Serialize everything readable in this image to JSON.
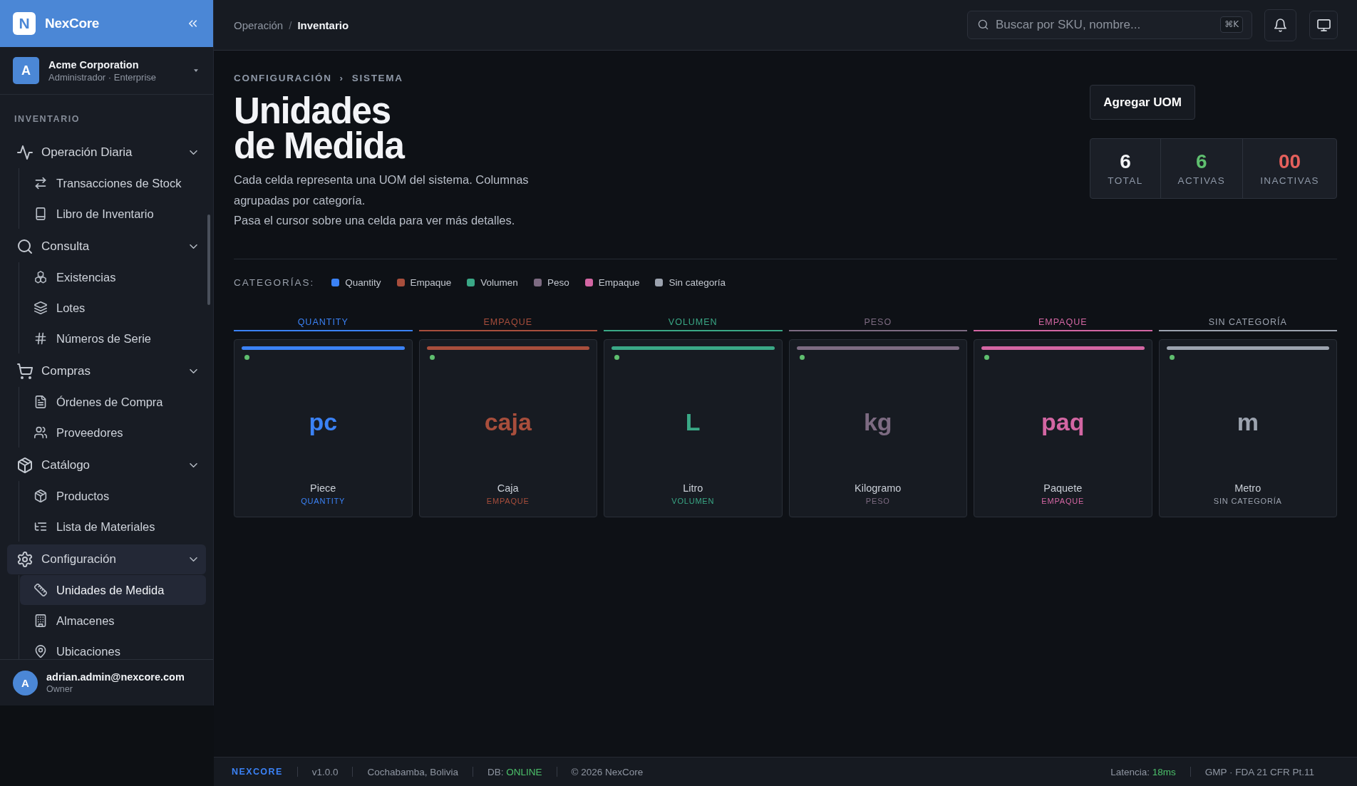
{
  "sidebar": {
    "brand": {
      "logo_letter": "N",
      "name": "NexCore"
    },
    "organization": {
      "avatar_letter": "A",
      "name": "Acme Corporation",
      "subtitle": "Administrador · Enterprise"
    },
    "section_label": "INVENTARIO",
    "groups": [
      {
        "label": "Operación Diaria",
        "expanded": true,
        "selected": false,
        "children": [
          {
            "label": "Transacciones de Stock",
            "selected": false
          },
          {
            "label": "Libro de Inventario",
            "selected": false
          }
        ]
      },
      {
        "label": "Consulta",
        "expanded": true,
        "selected": false,
        "children": [
          {
            "label": "Existencias",
            "selected": false
          },
          {
            "label": "Lotes",
            "selected": false
          },
          {
            "label": "Números de Serie",
            "selected": false
          }
        ]
      },
      {
        "label": "Compras",
        "expanded": true,
        "selected": false,
        "children": [
          {
            "label": "Órdenes de Compra",
            "selected": false
          },
          {
            "label": "Proveedores",
            "selected": false
          }
        ]
      },
      {
        "label": "Catálogo",
        "expanded": true,
        "selected": false,
        "children": [
          {
            "label": "Productos",
            "selected": false
          },
          {
            "label": "Lista de Materiales",
            "selected": false
          }
        ]
      },
      {
        "label": "Configuración",
        "expanded": true,
        "selected": true,
        "children": [
          {
            "label": "Unidades de Medida",
            "selected": true
          },
          {
            "label": "Almacenes",
            "selected": false
          },
          {
            "label": "Ubicaciones",
            "selected": false
          }
        ]
      }
    ],
    "user": {
      "avatar_letter": "A",
      "email": "adrian.admin@nexcore.com",
      "role": "Owner"
    }
  },
  "top_bar": {
    "breadcrumb": [
      {
        "label": "Operación",
        "current": false
      },
      {
        "label": "Inventario",
        "current": true
      }
    ],
    "breadcrumb_separator": "/",
    "search": {
      "placeholder": "Buscar por SKU, nombre...",
      "shortcut": "⌘K"
    }
  },
  "page": {
    "eyebrow": [
      "CONFIGURACIÓN",
      "SISTEMA"
    ],
    "eyebrow_separator": "›",
    "title": "Unidades de Medida",
    "description": [
      "Cada celda representa una UOM del sistema. Columnas agrupadas por categoría.",
      "Pasa el cursor sobre una celda para ver más detalles."
    ],
    "add_button": "Agregar UOM",
    "stats": [
      {
        "value": "6",
        "label": "TOTAL",
        "color": "#f3f4f6"
      },
      {
        "value": "6",
        "label": "ACTIVAS",
        "color": "#5fbf6f"
      },
      {
        "value": "00",
        "label": "INACTIVAS",
        "color": "#e5605c"
      }
    ]
  },
  "legend": {
    "label": "CATEGORÍAS:",
    "items": [
      {
        "label": "Quantity",
        "color": "#3b82f6"
      },
      {
        "label": "Empaque",
        "color": "#a84e3c"
      },
      {
        "label": "Volumen",
        "color": "#3aa886"
      },
      {
        "label": "Peso",
        "color": "#7d6b82"
      },
      {
        "label": "Empaque",
        "color": "#d366a3"
      },
      {
        "label": "Sin categoría",
        "color": "#9ca3af"
      }
    ]
  },
  "columns": [
    {
      "header": "QUANTITY",
      "color": "#3b82f6",
      "cards": [
        {
          "symbol": "pc",
          "name": "Piece",
          "category": "QUANTITY",
          "active": true
        }
      ]
    },
    {
      "header": "EMPAQUE",
      "color": "#a84e3c",
      "cards": [
        {
          "symbol": "caja",
          "name": "Caja",
          "category": "EMPAQUE",
          "active": true
        }
      ]
    },
    {
      "header": "VOLUMEN",
      "color": "#3aa886",
      "cards": [
        {
          "symbol": "L",
          "name": "Litro",
          "category": "VOLUMEN",
          "active": true
        }
      ]
    },
    {
      "header": "PESO",
      "color": "#7d6b82",
      "cards": [
        {
          "symbol": "kg",
          "name": "Kilogramo",
          "category": "PESO",
          "active": true
        }
      ]
    },
    {
      "header": "EMPAQUE",
      "color": "#d366a3",
      "cards": [
        {
          "symbol": "paq",
          "name": "Paquete",
          "category": "EMPAQUE",
          "active": true
        }
      ]
    },
    {
      "header": "SIN CATEGORÍA",
      "color": "#9ca3af",
      "cards": [
        {
          "symbol": "m",
          "name": "Metro",
          "category": "SIN CATEGORÍA",
          "active": true
        }
      ]
    }
  ],
  "status_bar": {
    "brand": "NEXCORE",
    "left": [
      {
        "label": "v1.0.0"
      },
      {
        "label": "Cochabamba, Bolivia"
      },
      {
        "label": "DB:",
        "value": "ONLINE"
      },
      {
        "label": "© 2026 NexCore"
      }
    ],
    "right": [
      {
        "label": "Latencia:",
        "value": "18ms"
      },
      {
        "label": "GMP · FDA 21 CFR Pt.11"
      }
    ]
  }
}
